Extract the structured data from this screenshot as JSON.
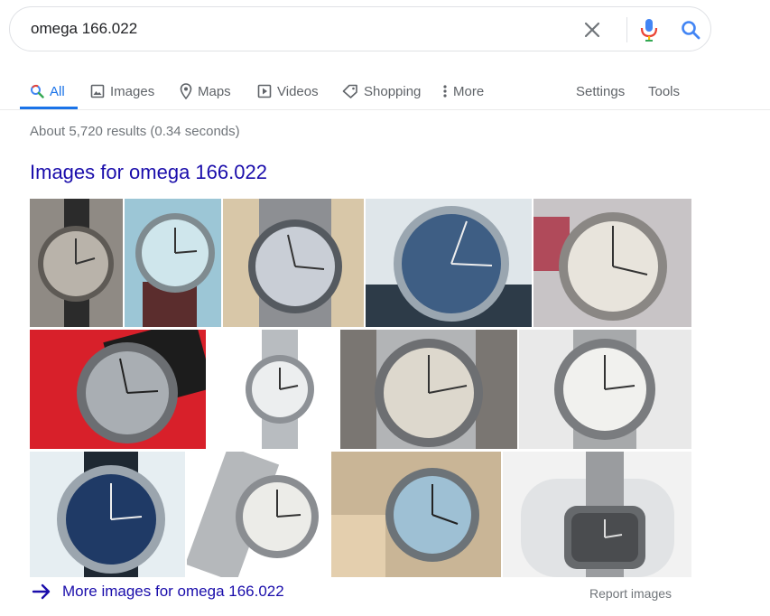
{
  "search": {
    "query": "omega 166.022"
  },
  "tabs": [
    {
      "label": "All",
      "icon": "search-icon"
    },
    {
      "label": "Images",
      "icon": "image-icon"
    },
    {
      "label": "Maps",
      "icon": "map-pin-icon"
    },
    {
      "label": "Videos",
      "icon": "video-icon"
    },
    {
      "label": "Shopping",
      "icon": "tag-icon"
    },
    {
      "label": "More",
      "icon": "more-vert-icon"
    }
  ],
  "tools": {
    "settings": "Settings",
    "tools": "Tools"
  },
  "result_stats": "About 5,720 results (0.34 seconds)",
  "images_block": {
    "heading": "Images for omega 166.022",
    "more_link": "More images for omega 166.022",
    "report": "Report images"
  },
  "colors": {
    "link": "#1a0dab",
    "accent": "#1a73e8",
    "muted": "#70757a"
  }
}
